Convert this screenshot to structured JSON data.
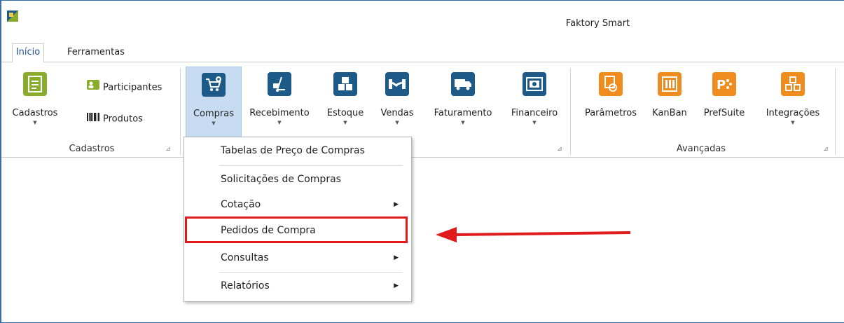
{
  "window": {
    "title": "Faktory Smart"
  },
  "tabs": [
    {
      "label": "Início",
      "active": true
    },
    {
      "label": "Ferramentas",
      "active": false
    }
  ],
  "ribbon": {
    "cadastros_group": {
      "label": "Cadastros",
      "big_button": "Cadastros",
      "small_buttons": [
        "Participantes",
        "Produtos"
      ]
    },
    "main_group": {
      "buttons": [
        "Compras",
        "Recebimento",
        "Estoque",
        "Vendas",
        "Faturamento",
        "Financeiro"
      ]
    },
    "avancadas_group": {
      "label": "Avançadas",
      "buttons": [
        "Parâmetros",
        "KanBan",
        "PrefSuite",
        "Integrações"
      ]
    }
  },
  "dropdown_menu": {
    "items": [
      {
        "label": "Tabelas de Preço de Compras",
        "submenu": false
      },
      {
        "label": "Solicitações de Compras",
        "submenu": false
      },
      {
        "label": "Cotação",
        "submenu": true
      },
      {
        "label": "Pedidos de Compra",
        "submenu": false,
        "highlighted": true
      },
      {
        "label": "Consultas",
        "submenu": true
      },
      {
        "label": "Relatórios",
        "submenu": true
      }
    ]
  },
  "colors": {
    "accent": "#1d5a87",
    "highlight": "#e01b1b",
    "pressed": "#c7dcf3"
  }
}
